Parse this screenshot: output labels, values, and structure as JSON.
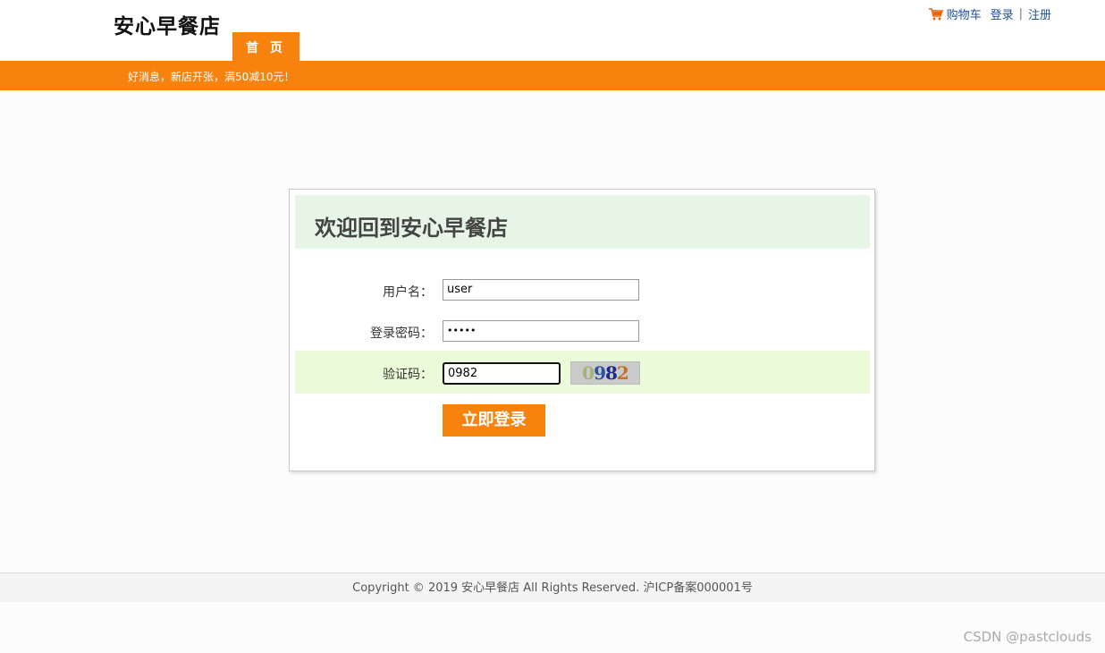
{
  "header": {
    "logo": "安心早餐店",
    "nav_home": "首 页",
    "cart": "购物车",
    "login": "登录",
    "separator": "|",
    "register": "注册"
  },
  "banner": {
    "text": "好消息，新店开张，满50减10元！"
  },
  "login_form": {
    "title": "欢迎回到安心早餐店",
    "username_label": "用户名：",
    "username_value": "user",
    "password_label": "登录密码：",
    "password_value": "•••••",
    "captcha_label": "验证码：",
    "captcha_value": "0982",
    "captcha_image": [
      "0",
      "9",
      "8",
      "2"
    ],
    "submit_label": "立即登录"
  },
  "footer": {
    "copyright": "Copyright © 2019 安心早餐店 All Rights Reserved. 沪ICP备案000001号"
  },
  "watermark": "CSDN @pastclouds",
  "colors": {
    "accent": "#f7820e",
    "title_bar": "#e6f5e6",
    "captcha_row": "#ebfbd9",
    "link": "#1f4e9c"
  },
  "icons": {
    "cart": "cart-icon"
  }
}
